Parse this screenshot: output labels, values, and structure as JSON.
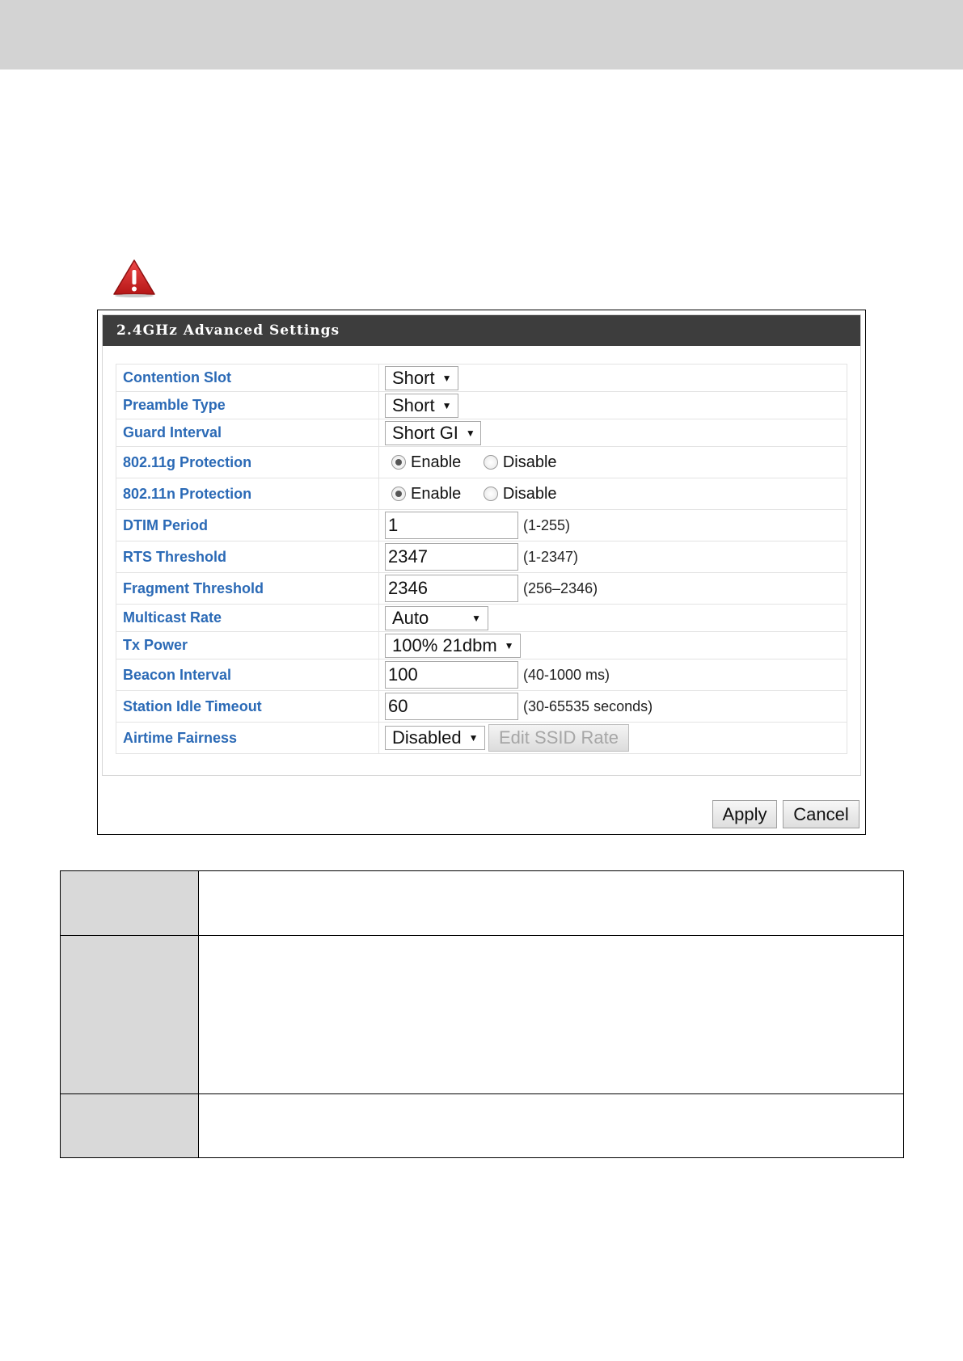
{
  "panel": {
    "title": "2.4GHz Advanced Settings"
  },
  "settings": {
    "contention_slot": {
      "label": "Contention Slot",
      "value": "Short"
    },
    "preamble_type": {
      "label": "Preamble Type",
      "value": "Short"
    },
    "guard_interval": {
      "label": "Guard Interval",
      "value": "Short GI"
    },
    "g_protection": {
      "label": "802.11g Protection",
      "enable": "Enable",
      "disable": "Disable",
      "selected": "Enable"
    },
    "n_protection": {
      "label": "802.11n Protection",
      "enable": "Enable",
      "disable": "Disable",
      "selected": "Enable"
    },
    "dtim_period": {
      "label": "DTIM Period",
      "value": "1",
      "hint": "(1-255)"
    },
    "rts_threshold": {
      "label": "RTS Threshold",
      "value": "2347",
      "hint": "(1-2347)"
    },
    "fragment_threshold": {
      "label": "Fragment Threshold",
      "value": "2346",
      "hint": "(256–2346)"
    },
    "multicast_rate": {
      "label": "Multicast Rate",
      "value": "Auto"
    },
    "tx_power": {
      "label": "Tx Power",
      "value": "100% 21dbm"
    },
    "beacon_interval": {
      "label": "Beacon Interval",
      "value": "100",
      "hint": "(40-1000 ms)"
    },
    "station_idle_timeout": {
      "label": "Station Idle Timeout",
      "value": "60",
      "hint": "(30-65535 seconds)"
    },
    "airtime_fairness": {
      "label": "Airtime Fairness",
      "value": "Disabled",
      "button": "Edit SSID Rate"
    }
  },
  "buttons": {
    "apply": "Apply",
    "cancel": "Cancel"
  },
  "icons": {
    "warning": "warning-triangle-icon",
    "dropdown": "triangle-down-icon"
  },
  "colors": {
    "label_blue": "#2b6ab6",
    "header_bg": "#3d3d3d",
    "warning_red": "#cc1f1f",
    "band_gray": "#d3d3d3"
  }
}
